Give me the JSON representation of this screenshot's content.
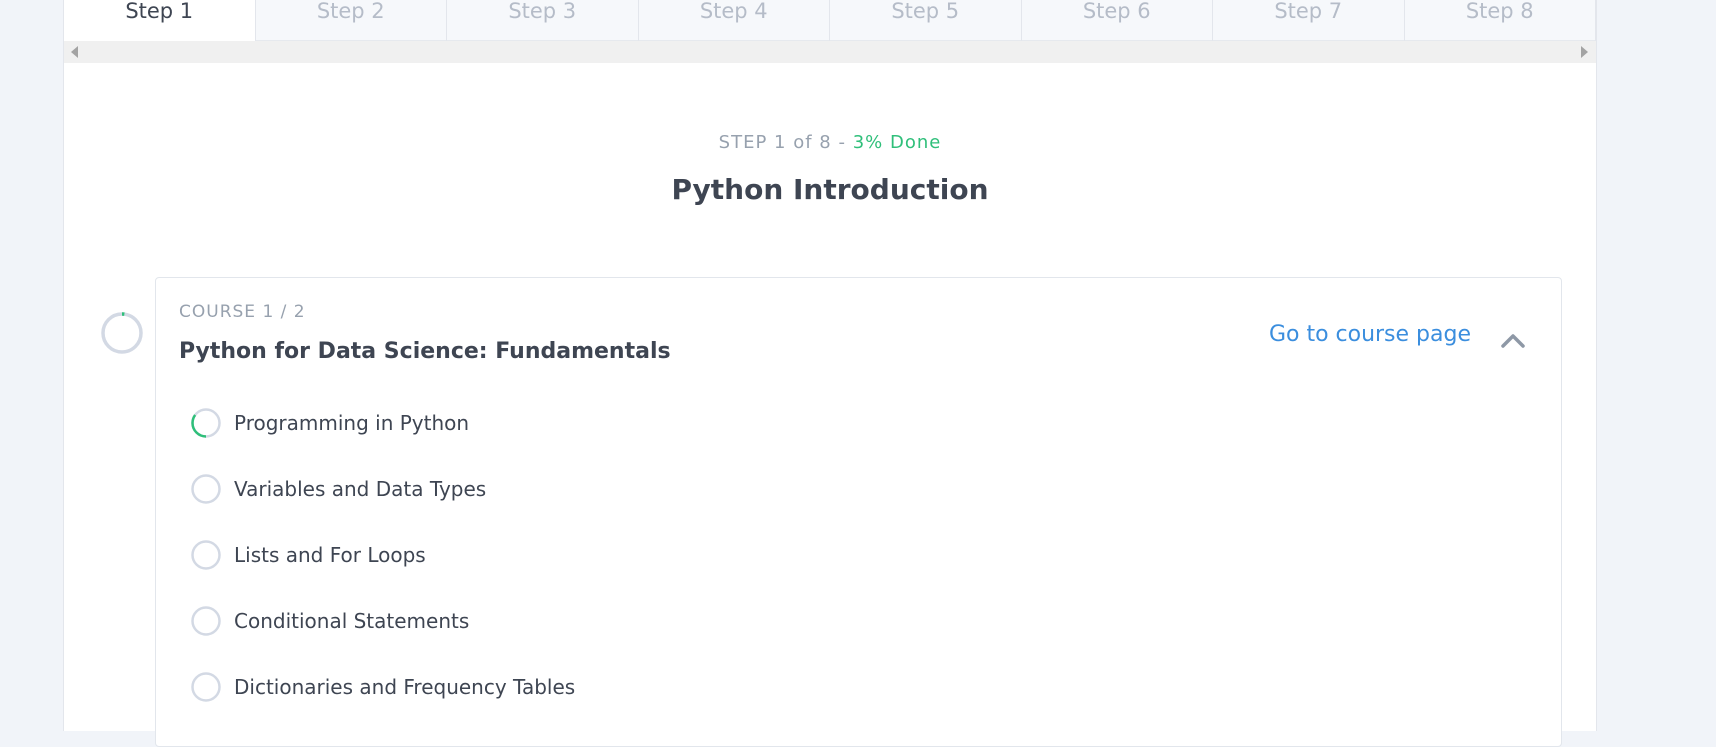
{
  "tabs": [
    "Step 1",
    "Step 2",
    "Step 3",
    "Step 4",
    "Step 5",
    "Step 6",
    "Step 7",
    "Step 8"
  ],
  "active_tab": 0,
  "step": {
    "header": "STEP 1 of 8 - ",
    "done": "3% Done",
    "title": "Python Introduction",
    "progress": 0.03
  },
  "course": {
    "label": "COURSE 1 / 2",
    "title": "Python for Data Science: Fundamentals",
    "link": "Go to course page",
    "progress": 0.02
  },
  "lessons": [
    {
      "label": "Programming in Python",
      "progress": 0.35
    },
    {
      "label": "Variables and Data Types",
      "progress": 0
    },
    {
      "label": "Lists and For Loops",
      "progress": 0
    },
    {
      "label": "Conditional Statements",
      "progress": 0
    },
    {
      "label": "Dictionaries and Frequency Tables",
      "progress": 0
    }
  ],
  "colors": {
    "accent_green": "#2fbf7a",
    "link_blue": "#3b8ede",
    "ring_gray": "#d3d9e4"
  },
  "icons": {
    "scroll_left": "triangle-left-icon",
    "scroll_right": "triangle-right-icon",
    "collapse": "chevron-up-icon"
  }
}
